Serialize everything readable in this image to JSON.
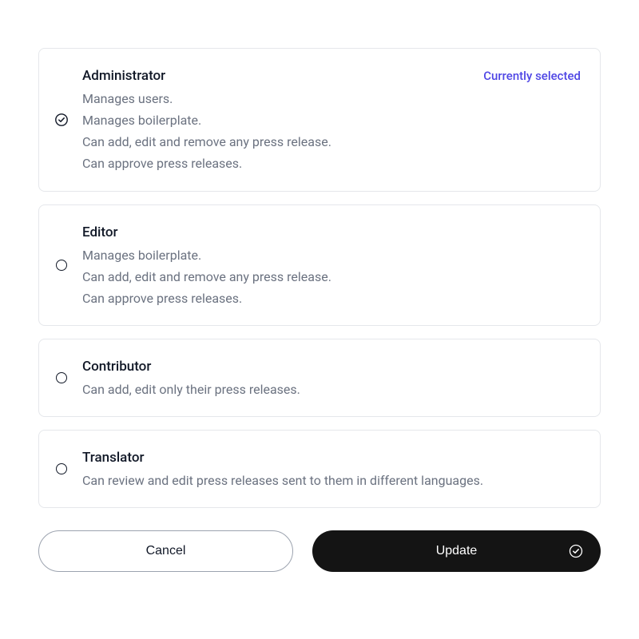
{
  "currently_selected_label": "Currently selected",
  "roles": [
    {
      "id": "administrator",
      "title": "Administrator",
      "description": "Manages users.\nManages boilerplate.\nCan add, edit and remove any press release.\nCan approve press releases.",
      "selected": true
    },
    {
      "id": "editor",
      "title": "Editor",
      "description": "Manages boilerplate.\nCan add, edit and remove any press release.\nCan approve press releases.",
      "selected": false
    },
    {
      "id": "contributor",
      "title": "Contributor",
      "description": "Can add, edit only their press releases.",
      "selected": false
    },
    {
      "id": "translator",
      "title": "Translator",
      "description": "Can review and edit press releases sent to them in different languages.",
      "selected": false
    }
  ],
  "buttons": {
    "cancel": "Cancel",
    "update": "Update"
  }
}
